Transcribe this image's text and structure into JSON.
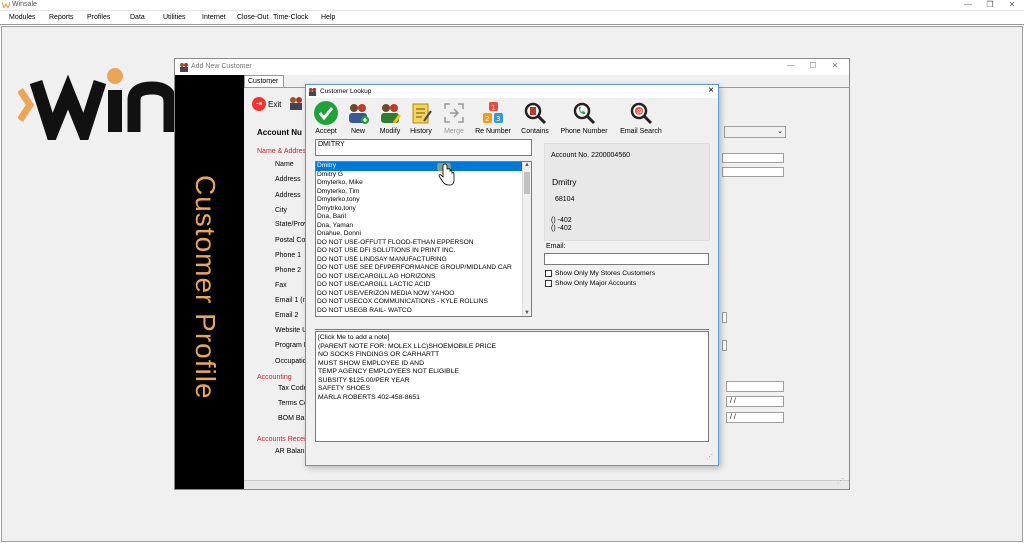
{
  "app": {
    "title": "Winsale",
    "menu": [
      "Modules",
      "Reports",
      "Profiles",
      "Data",
      "Utilities",
      "Internet",
      "Close-Out",
      "Time-Clock",
      "Help"
    ],
    "controls": {
      "minimize": "—",
      "restore": "❐",
      "close": "✕"
    }
  },
  "add_customer": {
    "title": "Add New Customer",
    "tab": "Customer",
    "sidebar_text": "Customer Profile",
    "exit_label": "Exit",
    "account_number_label": "Account Nu",
    "sections": {
      "name_address": "Name & Addres",
      "accounting": "Accounting",
      "accounts_receivable": "Accounts Recei"
    },
    "labels": [
      "Name",
      "Address",
      "Address",
      "City",
      "State/Prov",
      "Postal Co",
      "Phone 1",
      "Phone 2",
      "Fax",
      "Email 1 (n",
      "Email 2",
      "Website U",
      "Program I",
      "Occupatio"
    ],
    "accounting_labels": [
      "Tax Code",
      "Terms Co",
      "BOM Bal"
    ],
    "ar_label": "AR Balan",
    "date_placeholder_1": "/ /",
    "date_placeholder_2": "/ /",
    "controls": {
      "minimize": "—",
      "maximize": "☐",
      "close": "✕"
    }
  },
  "lookup": {
    "title": "Customer Lookup",
    "toolbar": [
      {
        "label": "Accept",
        "icon": "check-icon",
        "enabled": true
      },
      {
        "label": "New",
        "icon": "people-add-icon",
        "enabled": true
      },
      {
        "label": "Modify",
        "icon": "people-edit-icon",
        "enabled": true
      },
      {
        "label": "History",
        "icon": "history-icon",
        "enabled": true
      },
      {
        "label": "Merge",
        "icon": "merge-icon",
        "enabled": false
      },
      {
        "label": "Re Number",
        "icon": "renumber-icon",
        "enabled": true
      },
      {
        "label": "Contains",
        "icon": "search-icon",
        "enabled": true
      },
      {
        "label": "Phone Number",
        "icon": "phone-search-icon",
        "enabled": true
      },
      {
        "label": "Email Search",
        "icon": "email-search-icon",
        "enabled": true
      }
    ],
    "search_value": "DMITRY",
    "results": [
      "Dmitry",
      "Dmitry G",
      "Dmyterko, Mike",
      "Dmyterko, Tim",
      "Dmyterko,tony",
      "Dmytrko,tony",
      "Dna, Baril",
      "Dna, Yaman",
      "Dnahue, Donni",
      "DO NOT USE-OFFUTT FLOOD-ETHAN EPPERSON",
      "DO NOT USE DFI SOLUTIONS IN PRINT INC.",
      "DO NOT USE LINDSAY MANUFACTURING",
      "DO NOT USE SEE DFI/PERFORMANCE GROUP/MIDLAND CAR",
      "DO NOT USE/CARGILL AG HORIZONS",
      "DO NOT USE/CARGILL LACTIC ACID",
      "DO NOT USE/VERIZON MEDIA NOW YAHOO",
      "DO NOT USECOX COMMUNICATIONS - KYLE ROLLINS",
      "DO NOT USEGB RAIL- WATCO"
    ],
    "selected_index": 0,
    "info": {
      "account": "Account No. 2200004560",
      "name": "Dmitry",
      "zip": "68104",
      "phone1": "() -402",
      "phone2": "() -402"
    },
    "email_label": "Email:",
    "email_value": "",
    "checkbox_stores": "Show Only My Stores Customers",
    "checkbox_major": "Show Only Major Accounts",
    "notes": [
      "[Click Me to add a note]",
      "(PARENT NOTE FOR: MOLEX LLC)SHOEMOBILE PRICE",
      "NO SOCKS FINDINGS OR CARHARTT",
      "MUST SHOW EMPLOYEE ID AND",
      "TEMP AGENCY EMPLOYEES NOT ELIGIBLE",
      "SUBSITY $125.00/PER YEAR",
      "SAFETY SHOES",
      "MARLA ROBERTS 402-458-8651"
    ]
  },
  "colors": {
    "brand_orange": "#e9a658",
    "selection_blue": "#0078d7",
    "section_red": "#c0282b"
  }
}
